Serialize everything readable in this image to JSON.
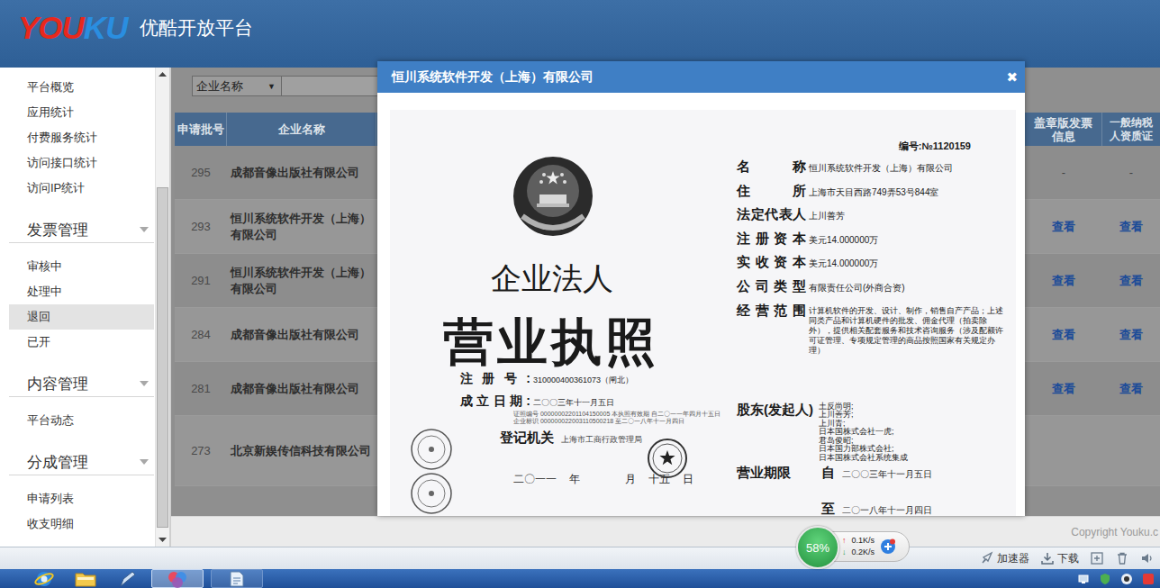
{
  "header": {
    "logo": [
      {
        "text": "YOU",
        "color": "#e8281d"
      },
      {
        "text": "KU",
        "color": "#2a8ee0"
      }
    ],
    "title": "优酷开放平台"
  },
  "sidebar": {
    "groups": [
      {
        "heading": null,
        "expanded": true,
        "items": [
          {
            "label": "平台概览",
            "selected": false
          },
          {
            "label": "应用统计",
            "selected": false
          },
          {
            "label": "付费服务统计",
            "selected": false
          },
          {
            "label": "访问接口统计",
            "selected": false
          },
          {
            "label": "访问IP统计",
            "selected": false
          }
        ]
      },
      {
        "heading": "发票管理",
        "expanded": true,
        "items": [
          {
            "label": "审核中",
            "selected": false
          },
          {
            "label": "处理中",
            "selected": false
          },
          {
            "label": "退回",
            "selected": true
          },
          {
            "label": "已开",
            "selected": false
          }
        ]
      },
      {
        "heading": "内容管理",
        "expanded": true,
        "items": [
          {
            "label": "平台动态",
            "selected": false
          }
        ]
      },
      {
        "heading": "分成管理",
        "expanded": true,
        "items": [
          {
            "label": "申请列表",
            "selected": false
          },
          {
            "label": "收支明细",
            "selected": false
          }
        ]
      }
    ]
  },
  "search": {
    "field": "企业名称",
    "arrow": "▼"
  },
  "table": {
    "columns": [
      "申请批号",
      "企业名称",
      "盖章版发票信息",
      "一般纳税人资质证"
    ],
    "rows": [
      {
        "batch": "295",
        "company": "成都音像出版社有限公司",
        "invoice": {
          "text": "-",
          "link": false
        },
        "taxpayer": {
          "text": "-",
          "link": false
        }
      },
      {
        "batch": "293",
        "company": "恒川系统软件开发（上海）有限公司",
        "invoice": {
          "text": "查看",
          "link": true
        },
        "taxpayer": {
          "text": "查看",
          "link": true
        }
      },
      {
        "batch": "291",
        "company": "恒川系统软件开发（上海）有限公司",
        "invoice": {
          "text": "查看",
          "link": true
        },
        "taxpayer": {
          "text": "查看",
          "link": true
        }
      },
      {
        "batch": "284",
        "company": "成都音像出版社有限公司",
        "invoice": {
          "text": "查看",
          "link": true
        },
        "taxpayer": {
          "text": "查看",
          "link": true
        }
      },
      {
        "batch": "281",
        "company": "成都音像出版社有限公司",
        "invoice": {
          "text": "查看",
          "link": true
        },
        "taxpayer": {
          "text": "查看",
          "link": true
        }
      },
      {
        "batch": "273",
        "company": "北京新娱传信科技有限公司",
        "invoice": null,
        "taxpayer": null
      }
    ]
  },
  "dialog": {
    "title": "恒川系统软件开发（上海）有限公司",
    "close": "✖",
    "license": {
      "number": "编号:№1120159",
      "heading_small": "企业法人",
      "heading": "营业执照",
      "left_fields": [
        {
          "label": "注册号:",
          "value": "310000400361073（闸北）"
        },
        {
          "label": "成立日期:",
          "value": "二〇〇三年十一月五日"
        }
      ],
      "fine_print": [
        "证照编号 00000002201104150005  本执照有效期 自二〇一一年四月十五日",
        "企业标识 000000022003110500218  至二〇一八年十一月四日"
      ],
      "authority": {
        "label": "登记机关",
        "value": "上海市工商行政管理局"
      },
      "issue_date": [
        "二〇一一",
        "年",
        "月",
        "十五",
        "日"
      ],
      "fields": [
        {
          "label": "名称",
          "value": "恒川系统软件开发（上海）有限公司"
        },
        {
          "label": "住所",
          "value": "上海市天目西路749弄53号844室"
        },
        {
          "label": "法定代表人",
          "value": "上川善芳"
        },
        {
          "label": "注册资本",
          "value": "美元14.000000万"
        },
        {
          "label": "实收资本",
          "value": "美元14.000000万"
        },
        {
          "label": "公司类型",
          "value": "有限责任公司(外商合资)"
        }
      ],
      "scope": {
        "label": "经营范围",
        "value": "计算机软件的开发、设计、制作，销售自产产品；上述同类产品和计算机硬件的批发、佣金代理（拍卖除外），提供相关配套服务和技术咨询服务（涉及配额许可证管理、专项规定管理的商品按照国家有关规定办理）"
      },
      "shareholders": {
        "label": "股东(发起人)",
        "names": [
          "土反尚明;",
          "上川善芳;",
          "上川青;",
          "日本国株式会社一虎;",
          "君岛俊昭;",
          "日本国力部株式会社;",
          "日本国株式会社系统集成"
        ]
      },
      "term": {
        "label": "营业期限",
        "from_mark": "自",
        "from": "二〇〇三年十一月五日",
        "to_mark": "至",
        "to": "二〇一八年十一月四日"
      }
    }
  },
  "footer": {
    "copyright": "Copyright Youku.c"
  },
  "network_widget": {
    "percent": "58%",
    "upload_arrow": "↑",
    "upload": "0.1K/s",
    "download_arrow": "↓",
    "download": "0.2K/s"
  },
  "status_bar": {
    "items": [
      {
        "kind": "accelerator",
        "label": "加速器"
      },
      {
        "kind": "download",
        "label": "下载"
      },
      {
        "kind": "add",
        "label": null
      },
      {
        "kind": "trash",
        "label": null
      },
      {
        "kind": "volume",
        "label": null
      }
    ]
  },
  "taskbar": {
    "apps": [
      {
        "kind": "browser",
        "selected": false
      },
      {
        "kind": "folder",
        "selected": false
      },
      {
        "kind": "editor",
        "selected": false
      },
      {
        "kind": "media",
        "selected": true
      },
      {
        "kind": "document",
        "selected": false
      }
    ]
  }
}
